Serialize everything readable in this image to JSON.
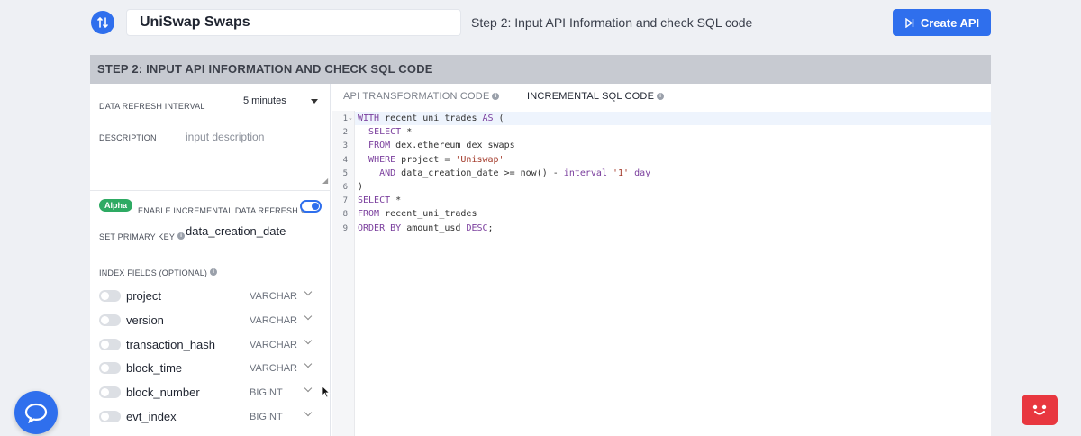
{
  "header": {
    "logo_icon": "swap-arrows-icon",
    "api_name": "UniSwap Swaps",
    "step_text": "Step 2: Input API Information and check SQL code",
    "create_button": "Create API",
    "create_icon": "play-skip-icon",
    "accent_color": "#2f6fed"
  },
  "panel": {
    "title": "STEP 2: INPUT API INFORMATION AND CHECK SQL CODE"
  },
  "settings": {
    "refresh_label": "DATA REFRESH INTERVAL",
    "refresh_value": "5 minutes",
    "description_label": "DESCRIPTION",
    "description_placeholder": "input description",
    "alpha_badge": "Alpha",
    "incremental_label": "ENABLE INCREMENTAL DATA REFRESH",
    "incremental_enabled": true,
    "primary_key_label": "SET PRIMARY KEY",
    "primary_key_value": "data_creation_date",
    "index_fields_label": "INDEX FIELDS (OPTIONAL)"
  },
  "fields": [
    {
      "name": "project",
      "type": "VARCHAR",
      "enabled": false
    },
    {
      "name": "version",
      "type": "VARCHAR",
      "enabled": false
    },
    {
      "name": "transaction_hash",
      "type": "VARCHAR",
      "enabled": false
    },
    {
      "name": "block_time",
      "type": "VARCHAR",
      "enabled": false
    },
    {
      "name": "block_number",
      "type": "BIGINT",
      "enabled": false
    },
    {
      "name": "evt_index",
      "type": "BIGINT",
      "enabled": false
    }
  ],
  "tabs": {
    "api_transformation": "API TRANSFORMATION CODE",
    "incremental_sql": "INCREMENTAL SQL CODE",
    "active": "incremental_sql"
  },
  "code_lines": [
    "WITH recent_uni_trades AS (",
    "  SELECT *",
    "  FROM dex.ethereum_dex_swaps",
    "  WHERE project = 'Uniswap'",
    "    AND data_creation_date >= now() - interval '1' day",
    ")",
    "SELECT *",
    "FROM recent_uni_trades",
    "ORDER BY amount_usd DESC;"
  ],
  "floating": {
    "chat_icon": "chat-bubble-icon",
    "bot_icon": "bot-face-icon"
  }
}
